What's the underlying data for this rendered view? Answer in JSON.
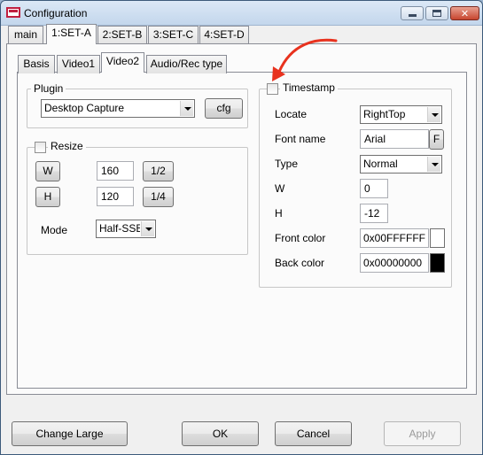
{
  "window": {
    "title": "Configuration"
  },
  "top_tabs": [
    {
      "label": "main",
      "active": false
    },
    {
      "label": "1:SET-A",
      "active": true
    },
    {
      "label": "2:SET-B",
      "active": false
    },
    {
      "label": "3:SET-C",
      "active": false
    },
    {
      "label": "4:SET-D",
      "active": false
    }
  ],
  "sub_tabs": [
    {
      "label": "Basis",
      "active": false
    },
    {
      "label": "Video1",
      "active": false
    },
    {
      "label": "Video2",
      "active": true
    },
    {
      "label": "Audio/Rec type",
      "active": false
    }
  ],
  "plugin": {
    "group_label": "Plugin",
    "selected": "Desktop Capture",
    "cfg_label": "cfg"
  },
  "resize": {
    "group_label": "Resize",
    "checked": false,
    "w_label": "W",
    "h_label": "H",
    "w_value": "160",
    "h_value": "120",
    "half_label": "1/2",
    "quarter_label": "1/4",
    "mode_label": "Mode",
    "mode_value": "Half-SSE"
  },
  "timestamp": {
    "group_label": "Timestamp",
    "checked": false,
    "locate_label": "Locate",
    "locate_value": "RightTop",
    "font_label": "Font name",
    "font_value": "Arial",
    "font_button": "F",
    "type_label": "Type",
    "type_value": "Normal",
    "w_label": "W",
    "w_value": "0",
    "h_label": "H",
    "h_value": "-12",
    "front_label": "Front color",
    "front_value": "0x00FFFFFF",
    "back_label": "Back color",
    "back_value": "0x00000000"
  },
  "colors": {
    "front_swatch": "#FFFFFF",
    "back_swatch": "#000000",
    "annotation_arrow": "#E8321E"
  },
  "footer": {
    "change_large": "Change Large",
    "ok": "OK",
    "cancel": "Cancel",
    "apply": "Apply"
  }
}
